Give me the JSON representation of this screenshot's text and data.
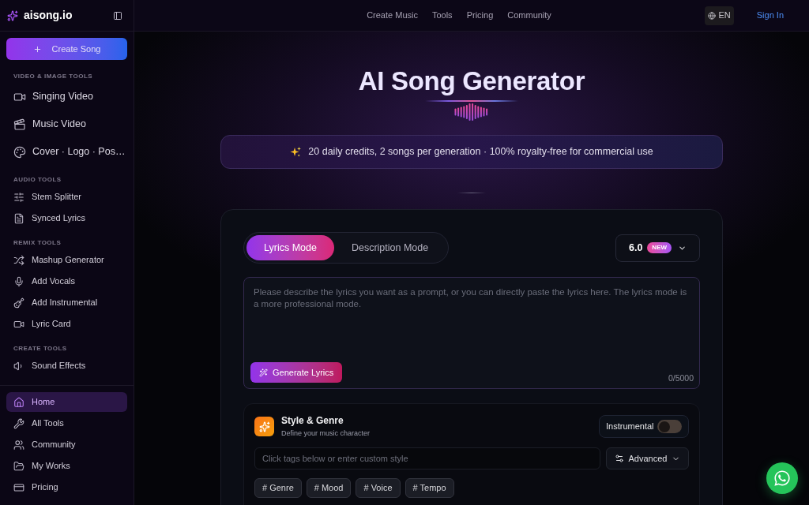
{
  "sidebar": {
    "logo": "aisong.io",
    "create_button": "Create Song",
    "sections": [
      {
        "title": "VIDEO & IMAGE TOOLS",
        "kind": "large",
        "items": [
          "Singing Video",
          "Music Video",
          "Cover · Logo · Pos…"
        ]
      },
      {
        "title": "AUDIO TOOLS",
        "kind": "compact",
        "items": [
          "Stem Splitter",
          "Synced Lyrics"
        ]
      },
      {
        "title": "REMIX TOOLS",
        "kind": "compact",
        "items": [
          "Mashup Generator",
          "Add Vocals",
          "Add Instrumental",
          "Lyric Card"
        ]
      },
      {
        "title": "CREATE TOOLS",
        "kind": "compact",
        "items": [
          "Sound Effects"
        ]
      }
    ],
    "nav": [
      {
        "label": "Home",
        "selected": true
      },
      {
        "label": "All Tools",
        "selected": false
      },
      {
        "label": "Community",
        "selected": false
      },
      {
        "label": "My Works",
        "selected": false
      },
      {
        "label": "Pricing",
        "selected": false
      }
    ]
  },
  "top_nav": {
    "links": [
      "Create Music",
      "Tools",
      "Pricing",
      "Community"
    ],
    "language": "EN",
    "sign_in": "Sign In"
  },
  "hero": {
    "title": "AI Song Generator",
    "banner": "20 daily credits, 2 songs per generation · 100% royalty-free for commercial use"
  },
  "generator": {
    "modes": [
      {
        "label": "Lyrics Mode",
        "selected": true
      },
      {
        "label": "Description Mode",
        "selected": false
      }
    ],
    "model": {
      "version": "6.0",
      "badge": "NEW"
    },
    "lyrics": {
      "placeholder": "Please describe the lyrics you want as a prompt, or you can directly paste the lyrics here. The lyrics mode is a more professional mode.",
      "generate_button": "Generate Lyrics",
      "counter": "0/5000"
    },
    "style": {
      "title": "Style & Genre",
      "subtitle": "Define your music character",
      "instrumental": {
        "label": "Instrumental",
        "on": false
      },
      "input": {
        "placeholder": "Click tags below or enter custom style"
      },
      "advanced_button": "Advanced",
      "tags": [
        "# Genre",
        "# Mood",
        "# Voice",
        "# Tempo"
      ]
    }
  }
}
